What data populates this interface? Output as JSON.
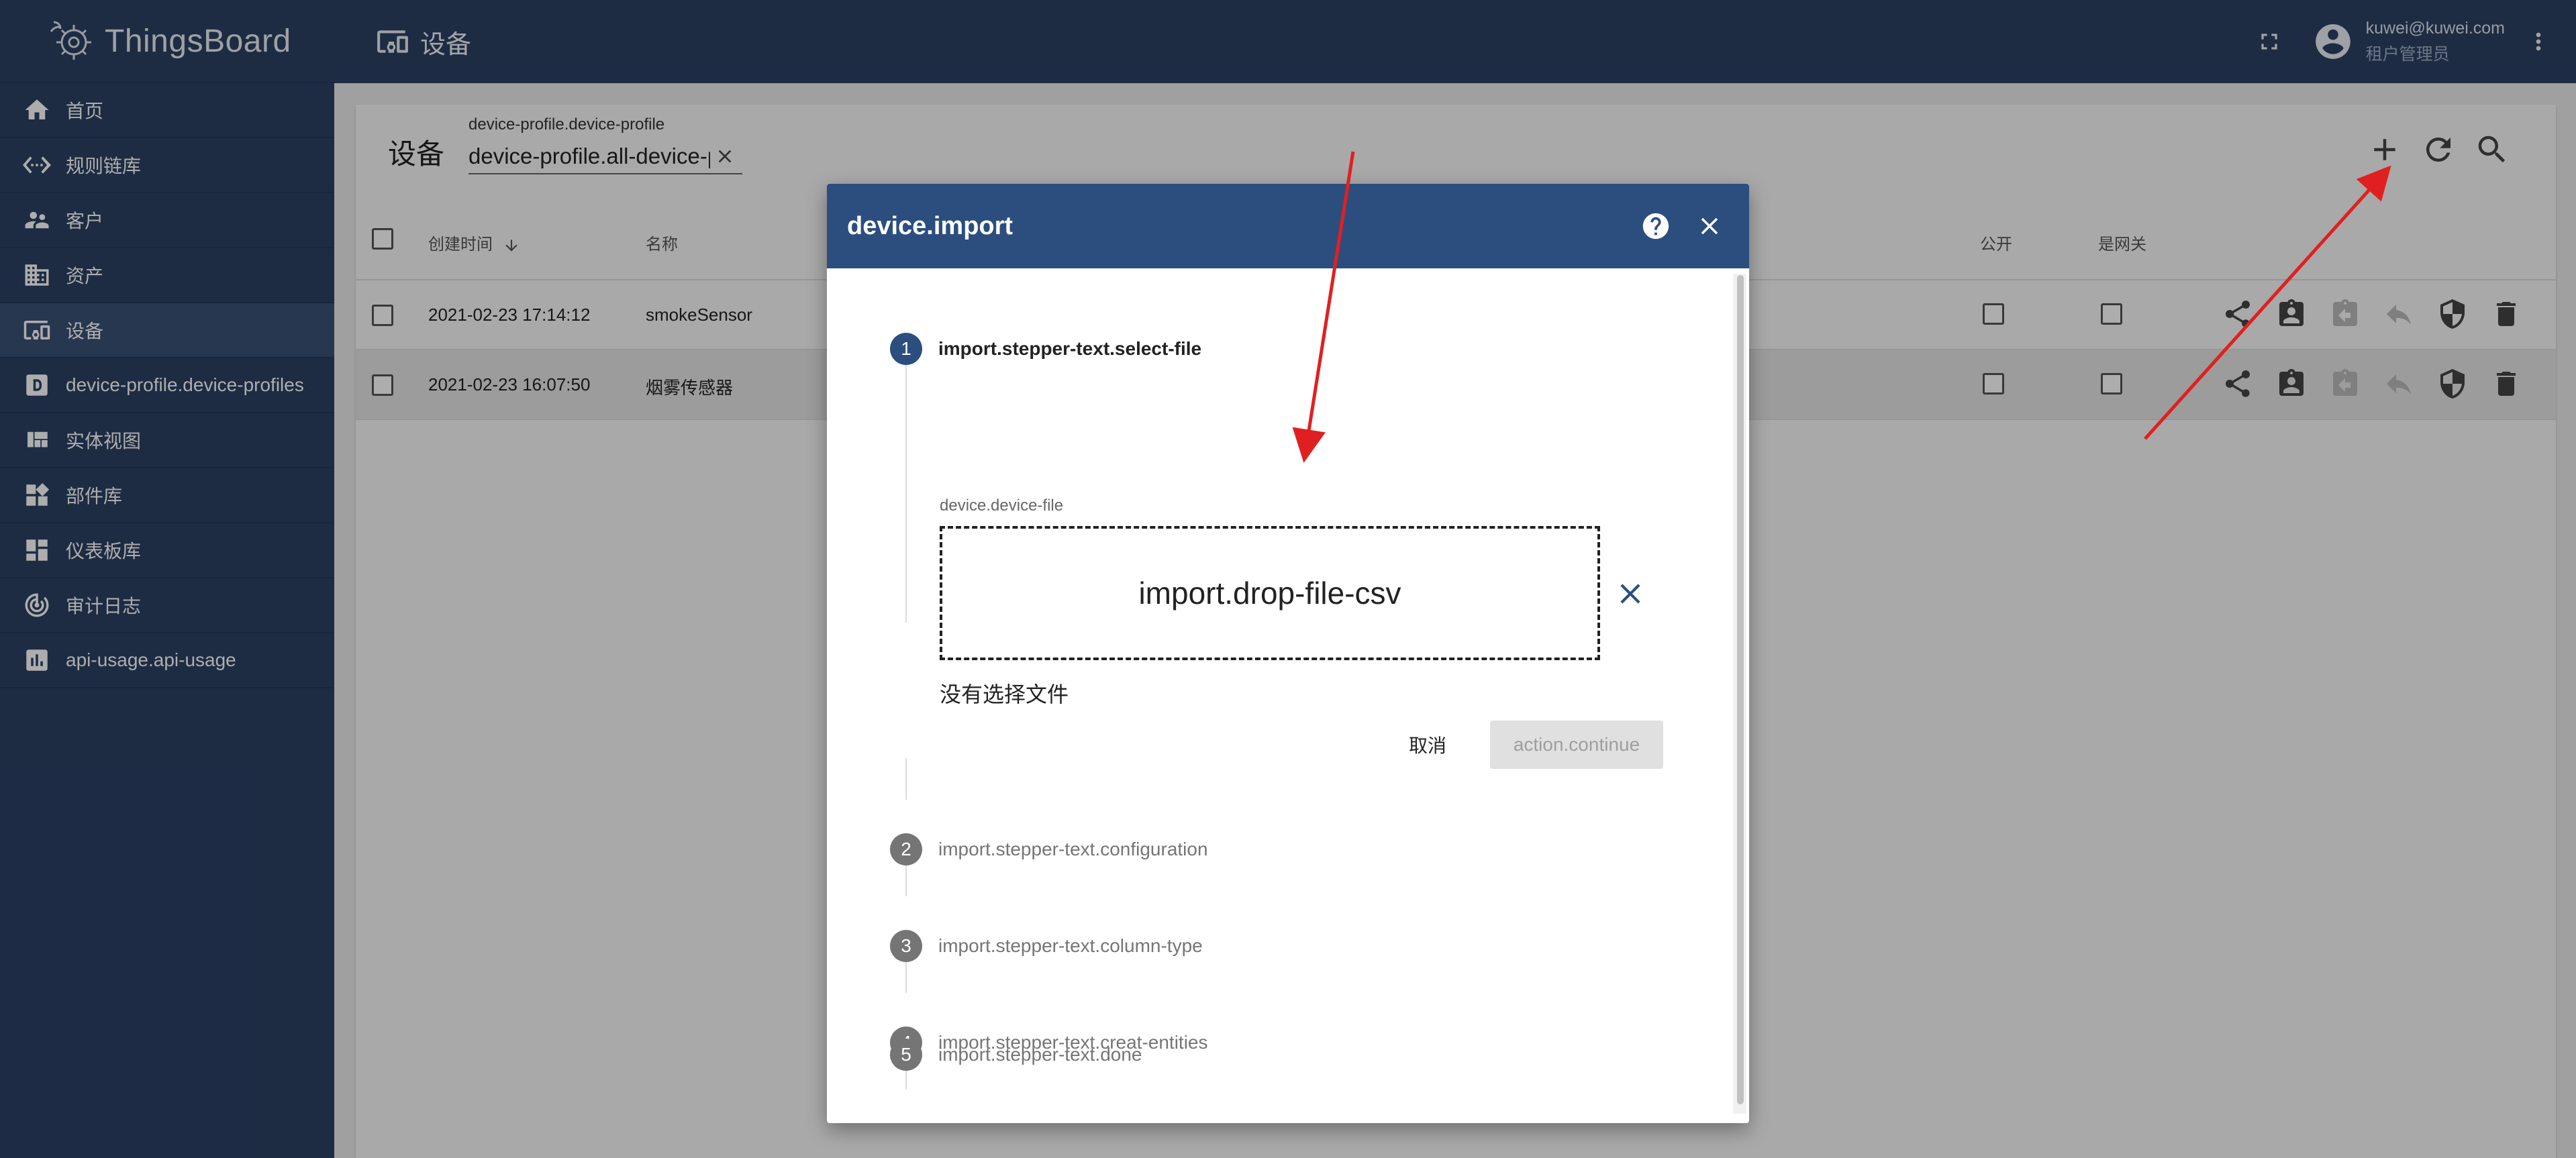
{
  "app": {
    "brand": "ThingsBoard"
  },
  "sidebar": {
    "items": [
      {
        "label": "首页",
        "icon": "home-icon"
      },
      {
        "label": "规则链库",
        "icon": "settings-ethernet-icon"
      },
      {
        "label": "客户",
        "icon": "supervisor-account-icon"
      },
      {
        "label": "资产",
        "icon": "domain-icon"
      },
      {
        "label": "设备",
        "icon": "devices-other-icon",
        "active": true
      },
      {
        "label": "device-profile.device-profiles",
        "icon": "device-profile-icon"
      },
      {
        "label": "实体视图",
        "icon": "view-quilt-icon"
      },
      {
        "label": "部件库",
        "icon": "widgets-icon"
      },
      {
        "label": "仪表板库",
        "icon": "dashboards-icon"
      },
      {
        "label": "审计日志",
        "icon": "track-changes-icon"
      },
      {
        "label": "api-usage.api-usage",
        "icon": "insert-chart-icon"
      }
    ]
  },
  "topbar": {
    "title": "设备",
    "user_email": "kuwei@kuwei.com",
    "user_role": "租户管理员"
  },
  "card": {
    "title": "设备",
    "filter_label": "device-profile.device-profile",
    "filter_value": "device-profile.all-device-p"
  },
  "table": {
    "columns": {
      "created": "创建时间",
      "name": "名称",
      "public": "公开",
      "gateway": "是网关"
    },
    "rows": [
      {
        "created": "2021-02-23 17:14:12",
        "name": "smokeSensor"
      },
      {
        "created": "2021-02-23 16:07:50",
        "name": "烟雾传感器"
      }
    ]
  },
  "dialog": {
    "title": "device.import",
    "steps": [
      {
        "num": "1",
        "label": "import.stepper-text.select-file"
      },
      {
        "num": "2",
        "label": "import.stepper-text.configuration"
      },
      {
        "num": "3",
        "label": "import.stepper-text.column-type"
      },
      {
        "num": "4",
        "label": "import.stepper-text.creat-entities"
      },
      {
        "num": "5",
        "label": "import.stepper-text.done"
      }
    ],
    "file_label": "device.device-file",
    "drop_text": "import.drop-file-csv",
    "no_file": "没有选择文件",
    "cancel": "取消",
    "continue": "action.continue"
  },
  "colors": {
    "primary": "#2b4164",
    "dialog_header": "#2b4e7e",
    "arrow": "#e02020"
  }
}
